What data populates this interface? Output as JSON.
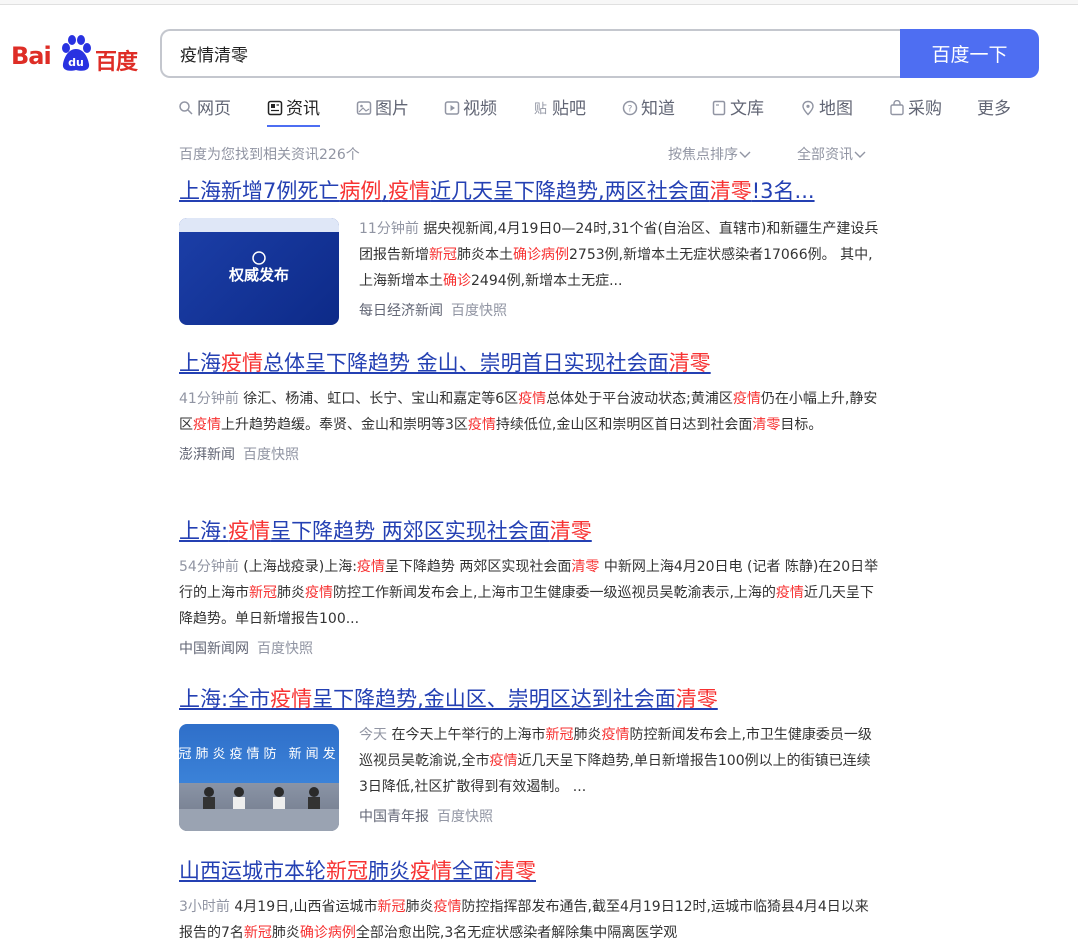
{
  "logo": {
    "left": "Bai",
    "mid": "du",
    "right": "百度"
  },
  "search": {
    "query": "疫情清零",
    "button": "百度一下"
  },
  "tabs": [
    {
      "label": "网页",
      "icon": "search-icon"
    },
    {
      "label": "资讯",
      "icon": "news-icon",
      "active": true
    },
    {
      "label": "图片",
      "icon": "image-icon"
    },
    {
      "label": "视频",
      "icon": "video-icon"
    },
    {
      "label": "贴吧",
      "icon": "tieba-icon"
    },
    {
      "label": "知道",
      "icon": "question-icon"
    },
    {
      "label": "文库",
      "icon": "doc-icon"
    },
    {
      "label": "地图",
      "icon": "map-pin-icon"
    },
    {
      "label": "采购",
      "icon": "purchase-icon"
    },
    {
      "label": "更多",
      "icon": ""
    }
  ],
  "meta": {
    "count": "百度为您找到相关资讯226个",
    "sort": "按焦点排序",
    "filter": "全部资讯"
  },
  "results": [
    {
      "title": [
        [
          "上海新增7例死亡",
          0
        ],
        [
          "病例",
          1
        ],
        [
          ",",
          0
        ],
        [
          "疫情",
          1
        ],
        [
          "近几天呈下降趋势,两区社会面",
          0
        ],
        [
          "清零",
          1
        ],
        [
          "!3名...",
          0
        ]
      ],
      "time": "11分钟前",
      "body": [
        [
          "据央视新闻,4月19日0—24时,31个省(自治区、直辖市)和新疆生产建设兵团报告新增",
          0
        ],
        [
          "新冠",
          1
        ],
        [
          "肺炎本土",
          0
        ],
        [
          "确诊病例",
          1
        ],
        [
          "2753例,新增本土无症状感染者17066例。 其中,上海新增本土",
          0
        ],
        [
          "确诊",
          1
        ],
        [
          "2494例,新增本土无症...",
          0
        ]
      ],
      "source": "每日经济新闻",
      "snapshot": "百度快照",
      "thumb": "authority-release",
      "thumb_text": "权威发布"
    },
    {
      "title": [
        [
          "上海",
          0
        ],
        [
          "疫情",
          1
        ],
        [
          "总体呈下降趋势 金山、崇明首日实现社会面",
          0
        ],
        [
          "清零",
          1
        ]
      ],
      "time": "41分钟前",
      "body": [
        [
          "徐汇、杨浦、虹口、长宁、宝山和嘉定等6区",
          0
        ],
        [
          "疫情",
          1
        ],
        [
          "总体处于平台波动状态;黄浦区",
          0
        ],
        [
          "疫情",
          1
        ],
        [
          "仍在小幅上升,静安区",
          0
        ],
        [
          "疫情",
          1
        ],
        [
          "上升趋势趋缓。奉贤、金山和崇明等3区",
          0
        ],
        [
          "疫情",
          1
        ],
        [
          "持续低位,金山区和崇明区首日达到社会面",
          0
        ],
        [
          "清零",
          1
        ],
        [
          "目标。",
          0
        ]
      ],
      "source": "澎湃新闻",
      "snapshot": "百度快照"
    },
    {
      "title": [
        [
          "上海:",
          0
        ],
        [
          "疫情",
          1
        ],
        [
          "呈下降趋势 两郊区实现社会面",
          0
        ],
        [
          "清零",
          1
        ]
      ],
      "time": "54分钟前",
      "body": [
        [
          "(上海战疫录)上海:",
          0
        ],
        [
          "疫情",
          1
        ],
        [
          "呈下降趋势 两郊区实现社会面",
          0
        ],
        [
          "清零",
          1
        ],
        [
          " 中新网上海4月20日电 (记者 陈静)在20日举行的上海市",
          0
        ],
        [
          "新冠",
          1
        ],
        [
          "肺炎",
          0
        ],
        [
          "疫情",
          1
        ],
        [
          "防控工作新闻发布会上,上海市卫生健康委一级巡视员吴乾渝表示,上海的",
          0
        ],
        [
          "疫情",
          1
        ],
        [
          "近几天呈下降趋势。单日新增报告100...",
          0
        ]
      ],
      "source": "中国新闻网",
      "snapshot": "百度快照"
    },
    {
      "title": [
        [
          "上海:全市",
          0
        ],
        [
          "疫情",
          1
        ],
        [
          "呈下降趋势,金山区、崇明区达到社会面",
          0
        ],
        [
          "清零",
          1
        ]
      ],
      "time": "今天",
      "body": [
        [
          "在今天上午举行的上海市",
          0
        ],
        [
          "新冠",
          1
        ],
        [
          "肺炎",
          0
        ],
        [
          "疫情",
          1
        ],
        [
          "防控新闻发布会上,市卫生健康委员一级巡视员吴乾渝说,全市",
          0
        ],
        [
          "疫情",
          1
        ],
        [
          "近几天呈下降趋势,单日新增报告100例以上的街镇已连续3日降低,社区扩散得到有效遏制。 ...",
          0
        ]
      ],
      "source": "中国青年报",
      "snapshot": "百度快照",
      "thumb": "press-conference",
      "thumb_text": "市新冠肺炎疫情防 新闻发布会"
    },
    {
      "title": [
        [
          "山西运城市本轮",
          0
        ],
        [
          "新冠",
          1
        ],
        [
          "肺炎",
          0
        ],
        [
          "疫情",
          1
        ],
        [
          "全面",
          0
        ],
        [
          "清零",
          1
        ]
      ],
      "time": "3小时前",
      "body": [
        [
          "4月19日,山西省运城市",
          0
        ],
        [
          "新冠",
          1
        ],
        [
          "肺炎",
          0
        ],
        [
          "疫情",
          1
        ],
        [
          "防控指挥部发布通告,截至4月19日12时,运城市临猗县4月4日以来报告的7名",
          0
        ],
        [
          "新冠",
          1
        ],
        [
          "肺炎",
          0
        ],
        [
          "确诊病例",
          1
        ],
        [
          "全部治愈出院,3名无症状感染者解除集中隔离医学观",
          0
        ]
      ],
      "source": "",
      "snapshot": ""
    }
  ],
  "colors": {
    "accent": "#4e6ef2",
    "link": "#2440b3",
    "highlight": "#f73131",
    "muted": "#9195a3"
  }
}
